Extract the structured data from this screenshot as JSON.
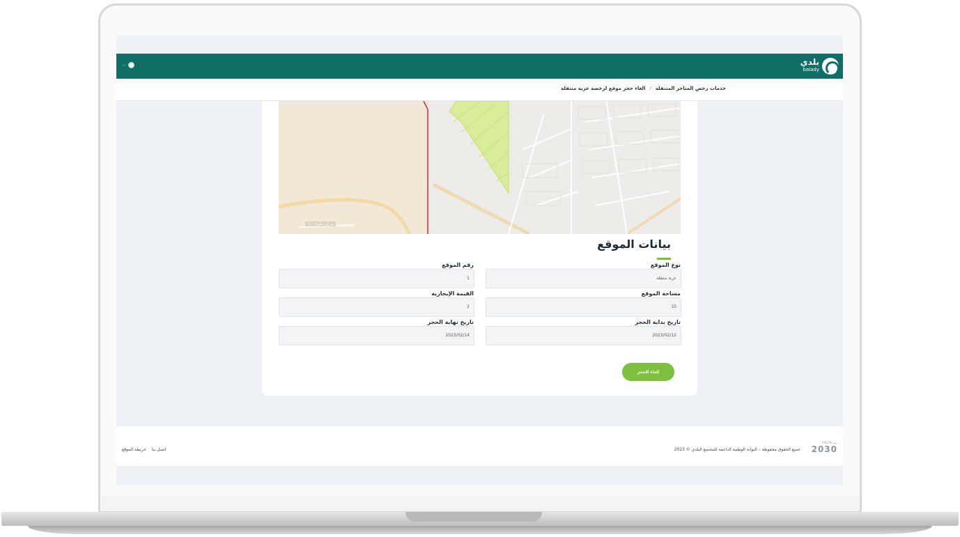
{
  "header": {
    "logo_text": "بلدي",
    "logo_sub": "balady"
  },
  "breadcrumb": {
    "items": [
      "خدمات رخص المتاجر المتنقلة",
      "الغاء حجز موقع لرخصة عربة متنقلة"
    ]
  },
  "map": {
    "place_label": "مركز ملبوع (يا)"
  },
  "section": {
    "title": "بيانات الموقع"
  },
  "fields": {
    "site_type": {
      "label": "نوع الموقع",
      "value": "عربة متنقلة"
    },
    "site_number": {
      "label": "رقم الموقع",
      "value": "1"
    },
    "site_area": {
      "label": "مساحة الموقع",
      "value": "15"
    },
    "rental_value": {
      "label": "القيمة الإيجارية",
      "value": "2"
    },
    "booking_start": {
      "label": "تاريخ بداية الحجز",
      "value": "2023/02/12"
    },
    "booking_end": {
      "label": "تاريخ نهاية الحجز",
      "value": "2023/02/14"
    }
  },
  "actions": {
    "cancel_booking": "إلغاء الحجز"
  },
  "footer": {
    "copyright": "جميع الحقوق محفوظة – البوابة الوطنية الداعمة للمجتمع البلدي © 2023",
    "links": [
      "اتصل بنا",
      "خريطة الموقع"
    ],
    "vision_small": "VISION رؤية",
    "vision_year": "2030"
  },
  "colors": {
    "header": "#0f6f66",
    "accent": "#7fbf3f",
    "page_bg": "#eef1f5"
  }
}
